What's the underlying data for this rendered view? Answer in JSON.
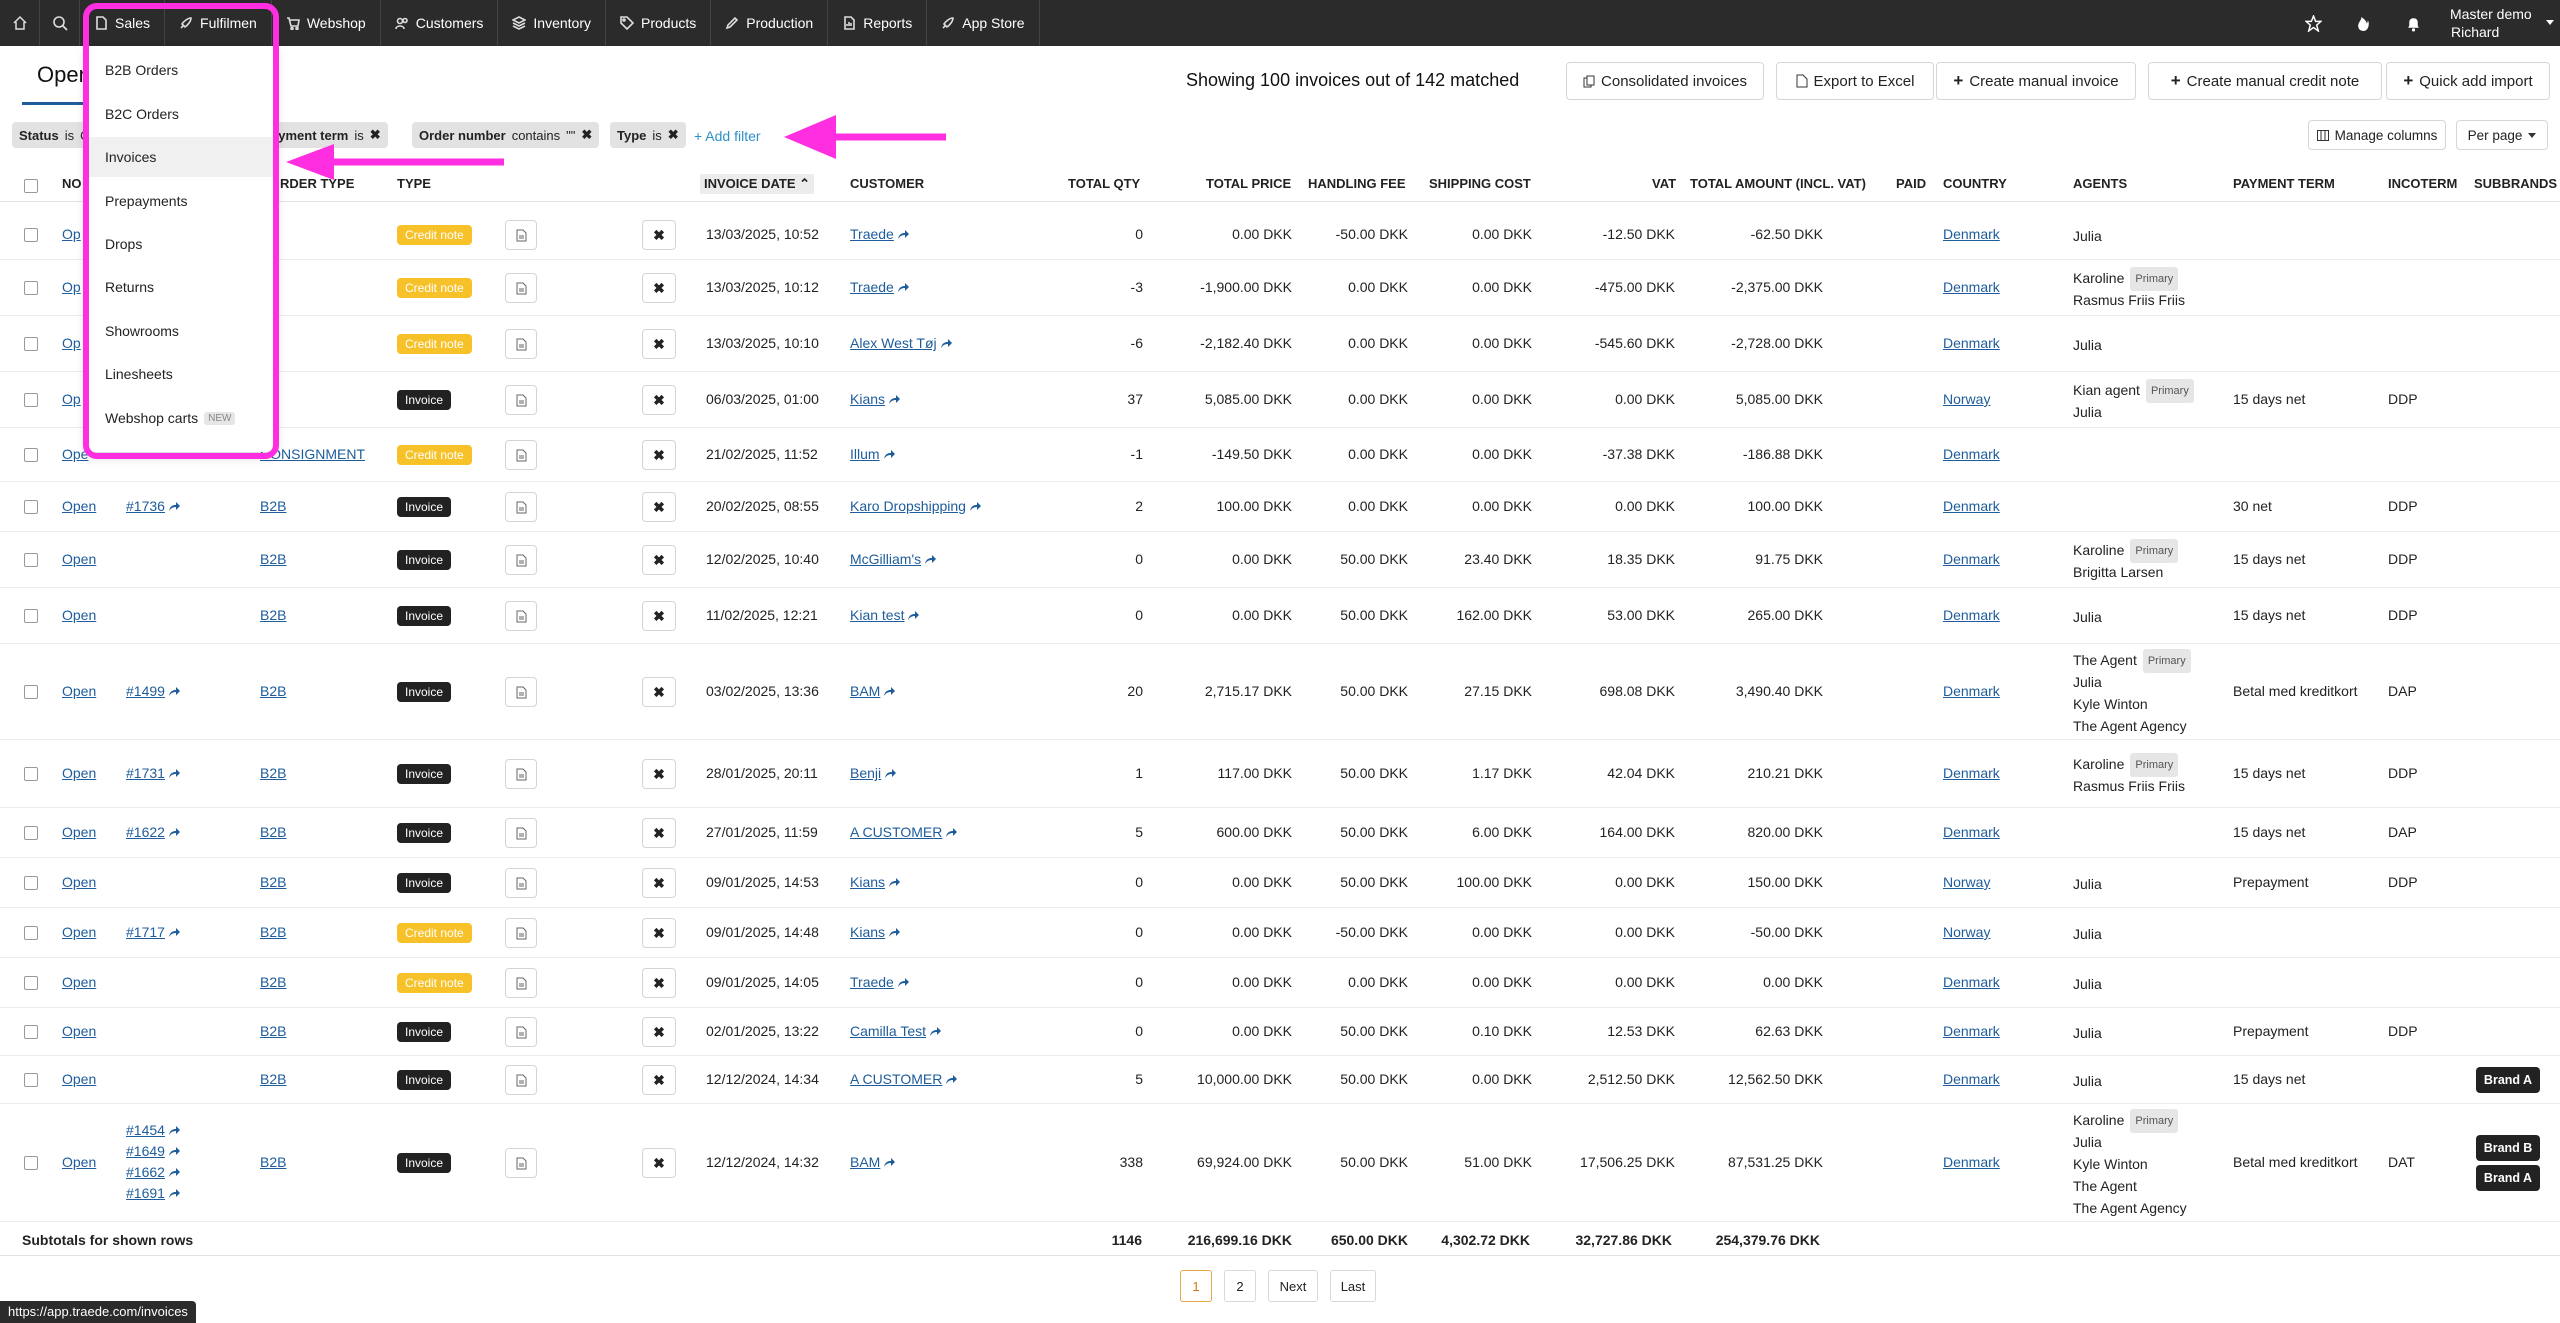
{
  "topnav": {
    "items": [
      {
        "label": "Sales",
        "icon": "file-icon"
      },
      {
        "label": "Fulfilmen",
        "icon": "rocket-icon"
      },
      {
        "label": "Webshop",
        "icon": "cart-icon"
      },
      {
        "label": "Customers",
        "icon": "users-icon"
      },
      {
        "label": "Inventory",
        "icon": "layers-icon"
      },
      {
        "label": "Products",
        "icon": "tag-icon"
      },
      {
        "label": "Production",
        "icon": "pen-icon"
      },
      {
        "label": "Reports",
        "icon": "report-icon"
      },
      {
        "label": "App Store",
        "icon": "rocket-icon"
      }
    ],
    "user": {
      "line1": "Master demo",
      "line2": "Richard"
    }
  },
  "sales_menu": {
    "items": [
      {
        "label": "B2B Orders"
      },
      {
        "label": "B2C Orders"
      },
      {
        "label": "Invoices"
      },
      {
        "label": "Prepayments"
      },
      {
        "label": "Drops"
      },
      {
        "label": "Returns"
      },
      {
        "label": "Showrooms"
      },
      {
        "label": "Linesheets"
      },
      {
        "label": "Webshop carts",
        "tag": "NEW"
      }
    ]
  },
  "header": {
    "tab": "Open",
    "showing": "Showing 100 invoices out of 142 matched",
    "buttons": {
      "consolidated": "Consolidated invoices",
      "export": "Export to Excel",
      "manual_invoice": "Create manual invoice",
      "manual_credit": "Create manual credit note",
      "quick_import": "Quick add import"
    }
  },
  "filters": {
    "status": {
      "key": "Status",
      "op": "is",
      "value": "O"
    },
    "payment": {
      "key": "ayment term",
      "op": "is"
    },
    "order": {
      "key": "Order number",
      "op": "contains",
      "value": "\"\""
    },
    "type": {
      "key": "Type",
      "op": "is"
    },
    "add": "Add filter",
    "manage": "Manage columns",
    "per_page": "Per page"
  },
  "columns": {
    "no": "NO",
    "order_type": "RDER TYPE",
    "type": "TYPE",
    "invoice_date": "INVOICE DATE",
    "customer": "CUSTOMER",
    "qty": "TOTAL QTY",
    "price": "TOTAL PRICE",
    "handling": "HANDLING FEE",
    "shipping": "SHIPPING COST",
    "vat": "VAT",
    "total": "TOTAL AMOUNT (INCL. VAT)",
    "paid": "PAID",
    "country": "COUNTRY",
    "agents": "AGENTS",
    "payment_term": "PAYMENT TERM",
    "incoterm": "INCOTERM",
    "subbrands": "SUBBRANDS"
  },
  "rows": [
    {
      "status": "Op",
      "orders": [],
      "otype": "2B",
      "type": "Credit note",
      "date": "13/03/2025, 10:52",
      "customer": "Traede",
      "qty": "0",
      "price": "0.00 DKK",
      "handling": "-50.00 DKK",
      "shipping": "0.00 DKK",
      "vat": "-12.50 DKK",
      "total": "-62.50 DKK",
      "country": "Denmark",
      "agents": [
        {
          "n": "Julia"
        }
      ],
      "term": "",
      "inco": "",
      "brands": []
    },
    {
      "status": "Op",
      "orders": [],
      "otype": "2B",
      "type": "Credit note",
      "date": "13/03/2025, 10:12",
      "customer": "Traede",
      "qty": "-3",
      "price": "-1,900.00 DKK",
      "handling": "0.00 DKK",
      "shipping": "0.00 DKK",
      "vat": "-475.00 DKK",
      "total": "-2,375.00 DKK",
      "country": "Denmark",
      "agents": [
        {
          "n": "Karoline",
          "p": "Primary"
        },
        {
          "n": "Rasmus Friis Friis"
        }
      ],
      "term": "",
      "inco": "",
      "brands": []
    },
    {
      "status": "Op",
      "orders": [],
      "otype": "2C",
      "type": "Credit note",
      "date": "13/03/2025, 10:10",
      "customer": "Alex West Tøj",
      "qty": "-6",
      "price": "-2,182.40 DKK",
      "handling": "0.00 DKK",
      "shipping": "0.00 DKK",
      "vat": "-545.60 DKK",
      "total": "-2,728.00 DKK",
      "country": "Denmark",
      "agents": [
        {
          "n": "Julia"
        }
      ],
      "term": "",
      "inco": "",
      "brands": []
    },
    {
      "status": "Op",
      "orders": [],
      "otype": "2B",
      "type": "Invoice",
      "date": "06/03/2025, 01:00",
      "customer": "Kians",
      "qty": "37",
      "price": "5,085.00 DKK",
      "handling": "0.00 DKK",
      "shipping": "0.00 DKK",
      "vat": "0.00 DKK",
      "total": "5,085.00 DKK",
      "country": "Norway",
      "agents": [
        {
          "n": "Kian agent",
          "p": "Primary"
        },
        {
          "n": "Julia"
        }
      ],
      "term": "15 days net",
      "inco": "DDP",
      "brands": []
    },
    {
      "status": "Ope",
      "orders": [],
      "otype": "CONSIGNMENT",
      "type": "Credit note",
      "date": "21/02/2025, 11:52",
      "customer": "Illum",
      "qty": "-1",
      "price": "-149.50 DKK",
      "handling": "0.00 DKK",
      "shipping": "0.00 DKK",
      "vat": "-37.38 DKK",
      "total": "-186.88 DKK",
      "country": "Denmark",
      "agents": [],
      "term": "",
      "inco": "",
      "brands": []
    },
    {
      "status": "Open",
      "orders": [
        "#1736"
      ],
      "otype": "B2B",
      "type": "Invoice",
      "date": "20/02/2025, 08:55",
      "customer": "Karo Dropshipping",
      "qty": "2",
      "price": "100.00 DKK",
      "handling": "0.00 DKK",
      "shipping": "0.00 DKK",
      "vat": "0.00 DKK",
      "total": "100.00 DKK",
      "country": "Denmark",
      "agents": [],
      "term": "30 net",
      "inco": "DDP",
      "brands": []
    },
    {
      "status": "Open",
      "orders": [],
      "otype": "B2B",
      "type": "Invoice",
      "date": "12/02/2025, 10:40",
      "customer": "McGilliam's",
      "qty": "0",
      "price": "0.00 DKK",
      "handling": "50.00 DKK",
      "shipping": "23.40 DKK",
      "vat": "18.35 DKK",
      "total": "91.75 DKK",
      "country": "Denmark",
      "agents": [
        {
          "n": "Karoline",
          "p": "Primary"
        },
        {
          "n": "Brigitta Larsen"
        }
      ],
      "term": "15 days net",
      "inco": "DDP",
      "brands": []
    },
    {
      "status": "Open",
      "orders": [],
      "otype": "B2B",
      "type": "Invoice",
      "date": "11/02/2025, 12:21",
      "customer": "Kian test",
      "qty": "0",
      "price": "0.00 DKK",
      "handling": "50.00 DKK",
      "shipping": "162.00 DKK",
      "vat": "53.00 DKK",
      "total": "265.00 DKK",
      "country": "Denmark",
      "agents": [
        {
          "n": "Julia"
        }
      ],
      "term": "15 days net",
      "inco": "DDP",
      "brands": []
    },
    {
      "status": "Open",
      "orders": [
        "#1499"
      ],
      "otype": "B2B",
      "type": "Invoice",
      "date": "03/02/2025, 13:36",
      "customer": "BAM",
      "qty": "20",
      "price": "2,715.17 DKK",
      "handling": "50.00 DKK",
      "shipping": "27.15 DKK",
      "vat": "698.08 DKK",
      "total": "3,490.40 DKK",
      "country": "Denmark",
      "agents": [
        {
          "n": "The Agent",
          "p": "Primary"
        },
        {
          "n": "Julia"
        },
        {
          "n": "Kyle Winton"
        },
        {
          "n": "The Agent Agency"
        }
      ],
      "term": "Betal med kreditkort",
      "inco": "DAP",
      "brands": []
    },
    {
      "status": "Open",
      "orders": [
        "#1731"
      ],
      "otype": "B2B",
      "type": "Invoice",
      "date": "28/01/2025, 20:11",
      "customer": "Benji",
      "qty": "1",
      "price": "117.00 DKK",
      "handling": "50.00 DKK",
      "shipping": "1.17 DKK",
      "vat": "42.04 DKK",
      "total": "210.21 DKK",
      "country": "Denmark",
      "agents": [
        {
          "n": "Karoline",
          "p": "Primary"
        },
        {
          "n": "Rasmus Friis Friis"
        }
      ],
      "term": "15 days net",
      "inco": "DDP",
      "brands": []
    },
    {
      "status": "Open",
      "orders": [
        "#1622"
      ],
      "otype": "B2B",
      "type": "Invoice",
      "date": "27/01/2025, 11:59",
      "customer": "A CUSTOMER",
      "qty": "5",
      "price": "600.00 DKK",
      "handling": "50.00 DKK",
      "shipping": "6.00 DKK",
      "vat": "164.00 DKK",
      "total": "820.00 DKK",
      "country": "Denmark",
      "agents": [],
      "term": "15 days net",
      "inco": "DAP",
      "brands": []
    },
    {
      "status": "Open",
      "orders": [],
      "otype": "B2B",
      "type": "Invoice",
      "date": "09/01/2025, 14:53",
      "customer": "Kians",
      "qty": "0",
      "price": "0.00 DKK",
      "handling": "50.00 DKK",
      "shipping": "100.00 DKK",
      "vat": "0.00 DKK",
      "total": "150.00 DKK",
      "country": "Norway",
      "agents": [
        {
          "n": "Julia"
        }
      ],
      "term": "Prepayment",
      "inco": "DDP",
      "brands": []
    },
    {
      "status": "Open",
      "orders": [
        "#1717"
      ],
      "otype": "B2B",
      "type": "Credit note",
      "date": "09/01/2025, 14:48",
      "customer": "Kians",
      "qty": "0",
      "price": "0.00 DKK",
      "handling": "-50.00 DKK",
      "shipping": "0.00 DKK",
      "vat": "0.00 DKK",
      "total": "-50.00 DKK",
      "country": "Norway",
      "agents": [
        {
          "n": "Julia"
        }
      ],
      "term": "",
      "inco": "",
      "brands": []
    },
    {
      "status": "Open",
      "orders": [],
      "otype": "B2B",
      "type": "Credit note",
      "date": "09/01/2025, 14:05",
      "customer": "Traede",
      "qty": "0",
      "price": "0.00 DKK",
      "handling": "0.00 DKK",
      "shipping": "0.00 DKK",
      "vat": "0.00 DKK",
      "total": "0.00 DKK",
      "country": "Denmark",
      "agents": [
        {
          "n": "Julia"
        }
      ],
      "term": "",
      "inco": "",
      "brands": []
    },
    {
      "status": "Open",
      "orders": [],
      "otype": "B2B",
      "type": "Invoice",
      "date": "02/01/2025, 13:22",
      "customer": "Camilla Test",
      "qty": "0",
      "price": "0.00 DKK",
      "handling": "50.00 DKK",
      "shipping": "0.10 DKK",
      "vat": "12.53 DKK",
      "total": "62.63 DKK",
      "country": "Denmark",
      "agents": [
        {
          "n": "Julia"
        }
      ],
      "term": "Prepayment",
      "inco": "DDP",
      "brands": []
    },
    {
      "status": "Open",
      "orders": [],
      "otype": "B2B",
      "type": "Invoice",
      "date": "12/12/2024, 14:34",
      "customer": "A CUSTOMER",
      "qty": "5",
      "price": "10,000.00 DKK",
      "handling": "50.00 DKK",
      "shipping": "0.00 DKK",
      "vat": "2,512.50 DKK",
      "total": "12,562.50 DKK",
      "country": "Denmark",
      "agents": [
        {
          "n": "Julia"
        }
      ],
      "term": "15 days net",
      "inco": "",
      "brands": [
        "Brand A"
      ]
    },
    {
      "status": "Open",
      "orders": [
        "#1454",
        "#1649",
        "#1662",
        "#1691"
      ],
      "otype": "B2B",
      "type": "Invoice",
      "date": "12/12/2024, 14:32",
      "customer": "BAM",
      "qty": "338",
      "price": "69,924.00 DKK",
      "handling": "50.00 DKK",
      "shipping": "51.00 DKK",
      "vat": "17,506.25 DKK",
      "total": "87,531.25 DKK",
      "country": "Denmark",
      "agents": [
        {
          "n": "Karoline",
          "p": "Primary"
        },
        {
          "n": "Julia"
        },
        {
          "n": "Kyle Winton"
        },
        {
          "n": "The Agent"
        },
        {
          "n": "The Agent Agency"
        }
      ],
      "term": "Betal med kreditkort",
      "inco": "DAT",
      "brands": [
        "Brand B",
        "Brand A"
      ]
    }
  ],
  "subtotals": {
    "label": "Subtotals for shown rows",
    "qty": "1146",
    "price": "216,699.16 DKK",
    "handling": "650.00 DKK",
    "shipping": "4,302.72 DKK",
    "vat": "32,727.86 DKK",
    "total": "254,379.76 DKK"
  },
  "pagination": {
    "pages": [
      "1",
      "2"
    ],
    "next": "Next",
    "last": "Last"
  },
  "statusbar": "https://app.traede.com/invoices",
  "colors": {
    "accent": "#1e5c9b",
    "highlight": "#ff2ee0",
    "credit": "#f7c12a",
    "navbar": "#2b2b2b"
  }
}
